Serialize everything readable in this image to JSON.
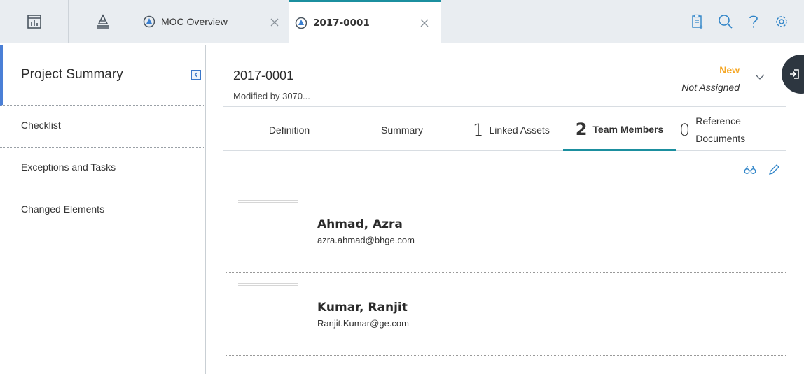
{
  "topbar": {
    "icon_tabs": [
      {
        "icon": "dashboard-icon"
      },
      {
        "icon": "asset-hierarchy-icon"
      }
    ],
    "tabs": [
      {
        "label": "MOC Overview",
        "active": false
      },
      {
        "label": "2017-0001",
        "active": true
      }
    ],
    "actions": [
      "clipboard-add-icon",
      "search-icon",
      "help-icon",
      "settings-icon"
    ]
  },
  "left_panel": {
    "title": "Project Summary",
    "items": [
      "Checklist",
      "Exceptions and Tasks",
      "Changed Elements"
    ]
  },
  "record": {
    "id": "2017-0001",
    "modified": "Modified by 3070...",
    "state": "New",
    "assignment": "Not Assigned"
  },
  "tabs": [
    {
      "label": "Definition"
    },
    {
      "label": "Summary"
    },
    {
      "count": "1",
      "label": "Linked Assets"
    },
    {
      "count": "2",
      "label": "Team Members",
      "active": true
    },
    {
      "count": "0",
      "label_line1": "Reference",
      "label_line2": "Documents"
    }
  ],
  "members": [
    {
      "name": "Ahmad, Azra",
      "email": "azra.ahmad@bhge.com"
    },
    {
      "name": "Kumar, Ranjit",
      "email": "Ranjit.Kumar@ge.com"
    }
  ],
  "colors": {
    "accent": "#1b8f9f",
    "state_new": "#f5a623",
    "left_accent": "#4a7fd6"
  }
}
